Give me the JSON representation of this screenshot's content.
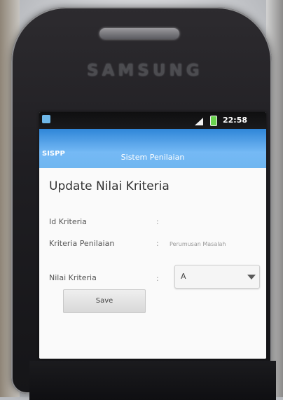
{
  "device": {
    "brand": "SAMSUNG"
  },
  "status_bar": {
    "time": "22:58"
  },
  "app": {
    "name": "SISPP",
    "title": "Sistem Penilaian"
  },
  "form": {
    "heading": "Update Nilai Kriteria",
    "fields": [
      {
        "label": "Id Kriteria",
        "colon": ":",
        "value": ""
      },
      {
        "label": "Kriteria Penilaian",
        "colon": ":",
        "value": "Perumusan Masalah"
      },
      {
        "label": "Nilai Kriteria",
        "colon": ":",
        "value": "A"
      }
    ],
    "save_label": "Save"
  },
  "icons": {
    "app_icon": "app-icon",
    "signal_icon": "signal-icon",
    "battery_icon": "battery-icon",
    "dropdown_icon": "dropdown-arrow-icon"
  },
  "colors": {
    "title_bar": "#6fb6f0",
    "screen_bg": "#fafafa",
    "phone_body": "#1f1e22"
  }
}
